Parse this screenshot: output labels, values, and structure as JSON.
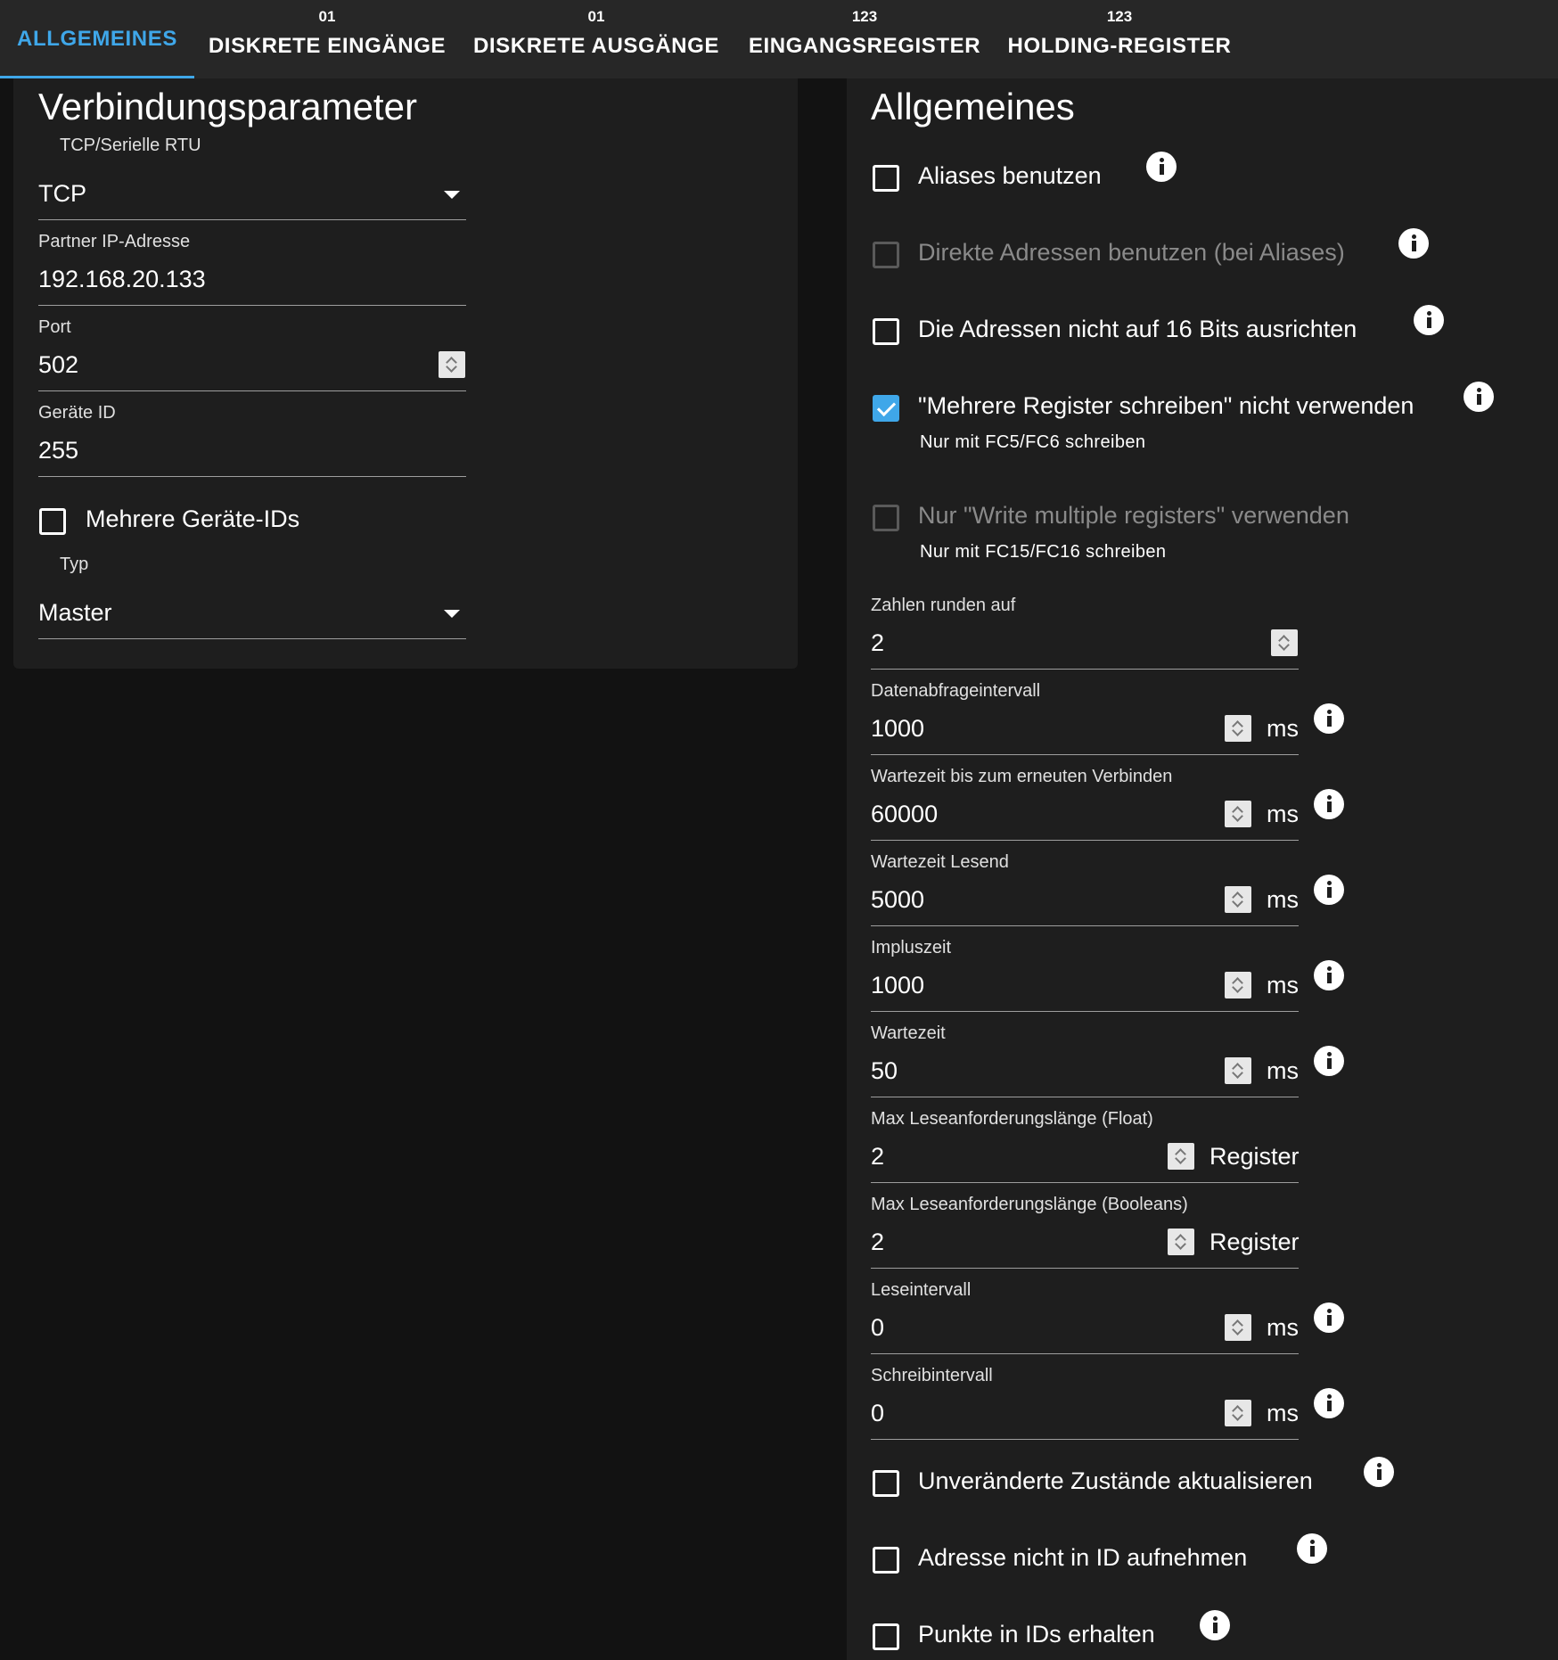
{
  "tabs": [
    {
      "label": "ALLGEMEINES",
      "icon": "",
      "active": true
    },
    {
      "label": "DISKRETE EINGÄNGE",
      "icon": "01"
    },
    {
      "label": "DISKRETE AUSGÄNGE",
      "icon": "01"
    },
    {
      "label": "EINGANGSREGISTER",
      "icon": "123"
    },
    {
      "label": "HOLDING-REGISTER",
      "icon": "123"
    }
  ],
  "connection": {
    "title": "Verbindungsparameter",
    "mode_label": "TCP/Serielle RTU",
    "mode_value": "TCP",
    "ip_label": "Partner IP-Adresse",
    "ip_value": "192.168.20.133",
    "port_label": "Port",
    "port_value": "502",
    "device_id_label": "Geräte ID",
    "device_id_value": "255",
    "multi_ids_label": "Mehrere Geräte-IDs",
    "type_label": "Typ",
    "type_value": "Master"
  },
  "general": {
    "title": "Allgemeines",
    "checkboxes": [
      {
        "label": "Aliases benutzen",
        "checked": false,
        "disabled": false,
        "sub": ""
      },
      {
        "label": "Direkte Adressen benutzen (bei Aliases)",
        "checked": false,
        "disabled": true,
        "sub": ""
      },
      {
        "label": "Die Adressen nicht auf 16 Bits ausrichten",
        "checked": false,
        "disabled": false,
        "sub": ""
      },
      {
        "label": "\"Mehrere Register schreiben\" nicht verwenden",
        "checked": true,
        "disabled": false,
        "sub": "Nur mit FC5/FC6 schreiben"
      },
      {
        "label": "Nur \"Write multiple registers\" verwenden",
        "checked": false,
        "disabled": true,
        "sub": "Nur mit FC15/FC16 schreiben"
      }
    ],
    "fields": [
      {
        "label": "Zahlen runden auf",
        "value": "2",
        "unit": ""
      },
      {
        "label": "Datenabfrageintervall",
        "value": "1000",
        "unit": "ms"
      },
      {
        "label": "Wartezeit bis zum erneuten Verbinden",
        "value": "60000",
        "unit": "ms"
      },
      {
        "label": "Wartezeit Lesend",
        "value": "5000",
        "unit": "ms"
      },
      {
        "label": "Impluszeit",
        "value": "1000",
        "unit": "ms"
      },
      {
        "label": "Wartezeit",
        "value": "50",
        "unit": "ms"
      },
      {
        "label": "Max Leseanforderungslänge (Float)",
        "value": "2",
        "unit": "Register"
      },
      {
        "label": "Max Leseanforderungslänge (Booleans)",
        "value": "2",
        "unit": "Register"
      },
      {
        "label": "Leseintervall",
        "value": "0",
        "unit": "ms"
      },
      {
        "label": "Schreibintervall",
        "value": "0",
        "unit": "ms"
      }
    ],
    "bottom_checkboxes": [
      {
        "label": "Unveränderte Zustände aktualisieren",
        "checked": false
      },
      {
        "label": "Adresse nicht in ID aufnehmen",
        "checked": false
      },
      {
        "label": "Punkte in IDs erhalten",
        "checked": false
      }
    ]
  },
  "colors": {
    "accent": "#3fa7e9",
    "panel": "#1e1e1e",
    "tabbar": "#272727",
    "background": "#121212"
  }
}
